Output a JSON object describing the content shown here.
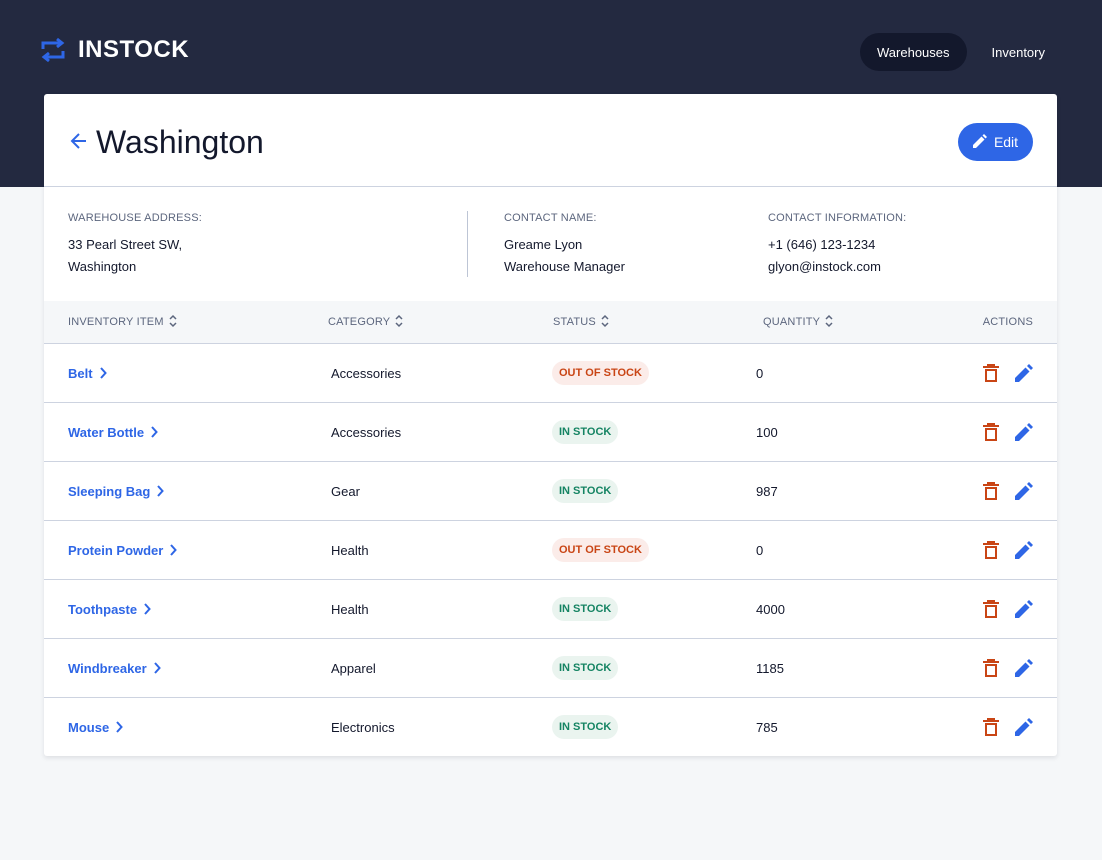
{
  "app": {
    "name": "INSTOCK"
  },
  "nav": {
    "warehouses": "Warehouses",
    "inventory": "Inventory"
  },
  "page": {
    "title": "Washington",
    "edit_label": "Edit"
  },
  "details": {
    "address_label": "WAREHOUSE ADDRESS:",
    "address_line1": "33 Pearl Street SW,",
    "address_line2": "Washington",
    "contact_name_label": "CONTACT NAME:",
    "contact_name": "Greame Lyon",
    "contact_position": "Warehouse Manager",
    "contact_info_label": "CONTACT INFORMATION:",
    "contact_phone": "+1 (646) 123-1234",
    "contact_email": "glyon@instock.com"
  },
  "table": {
    "headers": {
      "item": "INVENTORY ITEM",
      "category": "CATEGORY",
      "status": "STATUS",
      "quantity": "QUANTITY",
      "actions": "ACTIONS"
    },
    "rows": [
      {
        "item": "Belt",
        "category": "Accessories",
        "status": "OUT OF STOCK",
        "quantity": "0"
      },
      {
        "item": "Water Bottle",
        "category": "Accessories",
        "status": "IN STOCK",
        "quantity": "100"
      },
      {
        "item": "Sleeping Bag",
        "category": "Gear",
        "status": "IN STOCK",
        "quantity": "987"
      },
      {
        "item": "Protein Powder",
        "category": "Health",
        "status": "OUT OF STOCK",
        "quantity": "0"
      },
      {
        "item": "Toothpaste",
        "category": "Health",
        "status": "IN STOCK",
        "quantity": "4000"
      },
      {
        "item": "Windbreaker",
        "category": "Apparel",
        "status": "IN STOCK",
        "quantity": "1185"
      },
      {
        "item": "Mouse",
        "category": "Electronics",
        "status": "IN STOCK",
        "quantity": "785"
      }
    ]
  },
  "icons": {
    "logo": "swap-arrows-icon",
    "back": "arrow-back-icon",
    "edit": "pencil-icon",
    "sort": "sort-icon",
    "chevron": "chevron-right-icon",
    "delete": "trash-icon"
  },
  "colors": {
    "header_bg": "#232940",
    "accent": "#2e66e6",
    "out_of_stock": "#c94515",
    "in_stock": "#158463",
    "text": "#13182c",
    "secondary_text": "#5c667e",
    "background": "#f5f7f9"
  }
}
